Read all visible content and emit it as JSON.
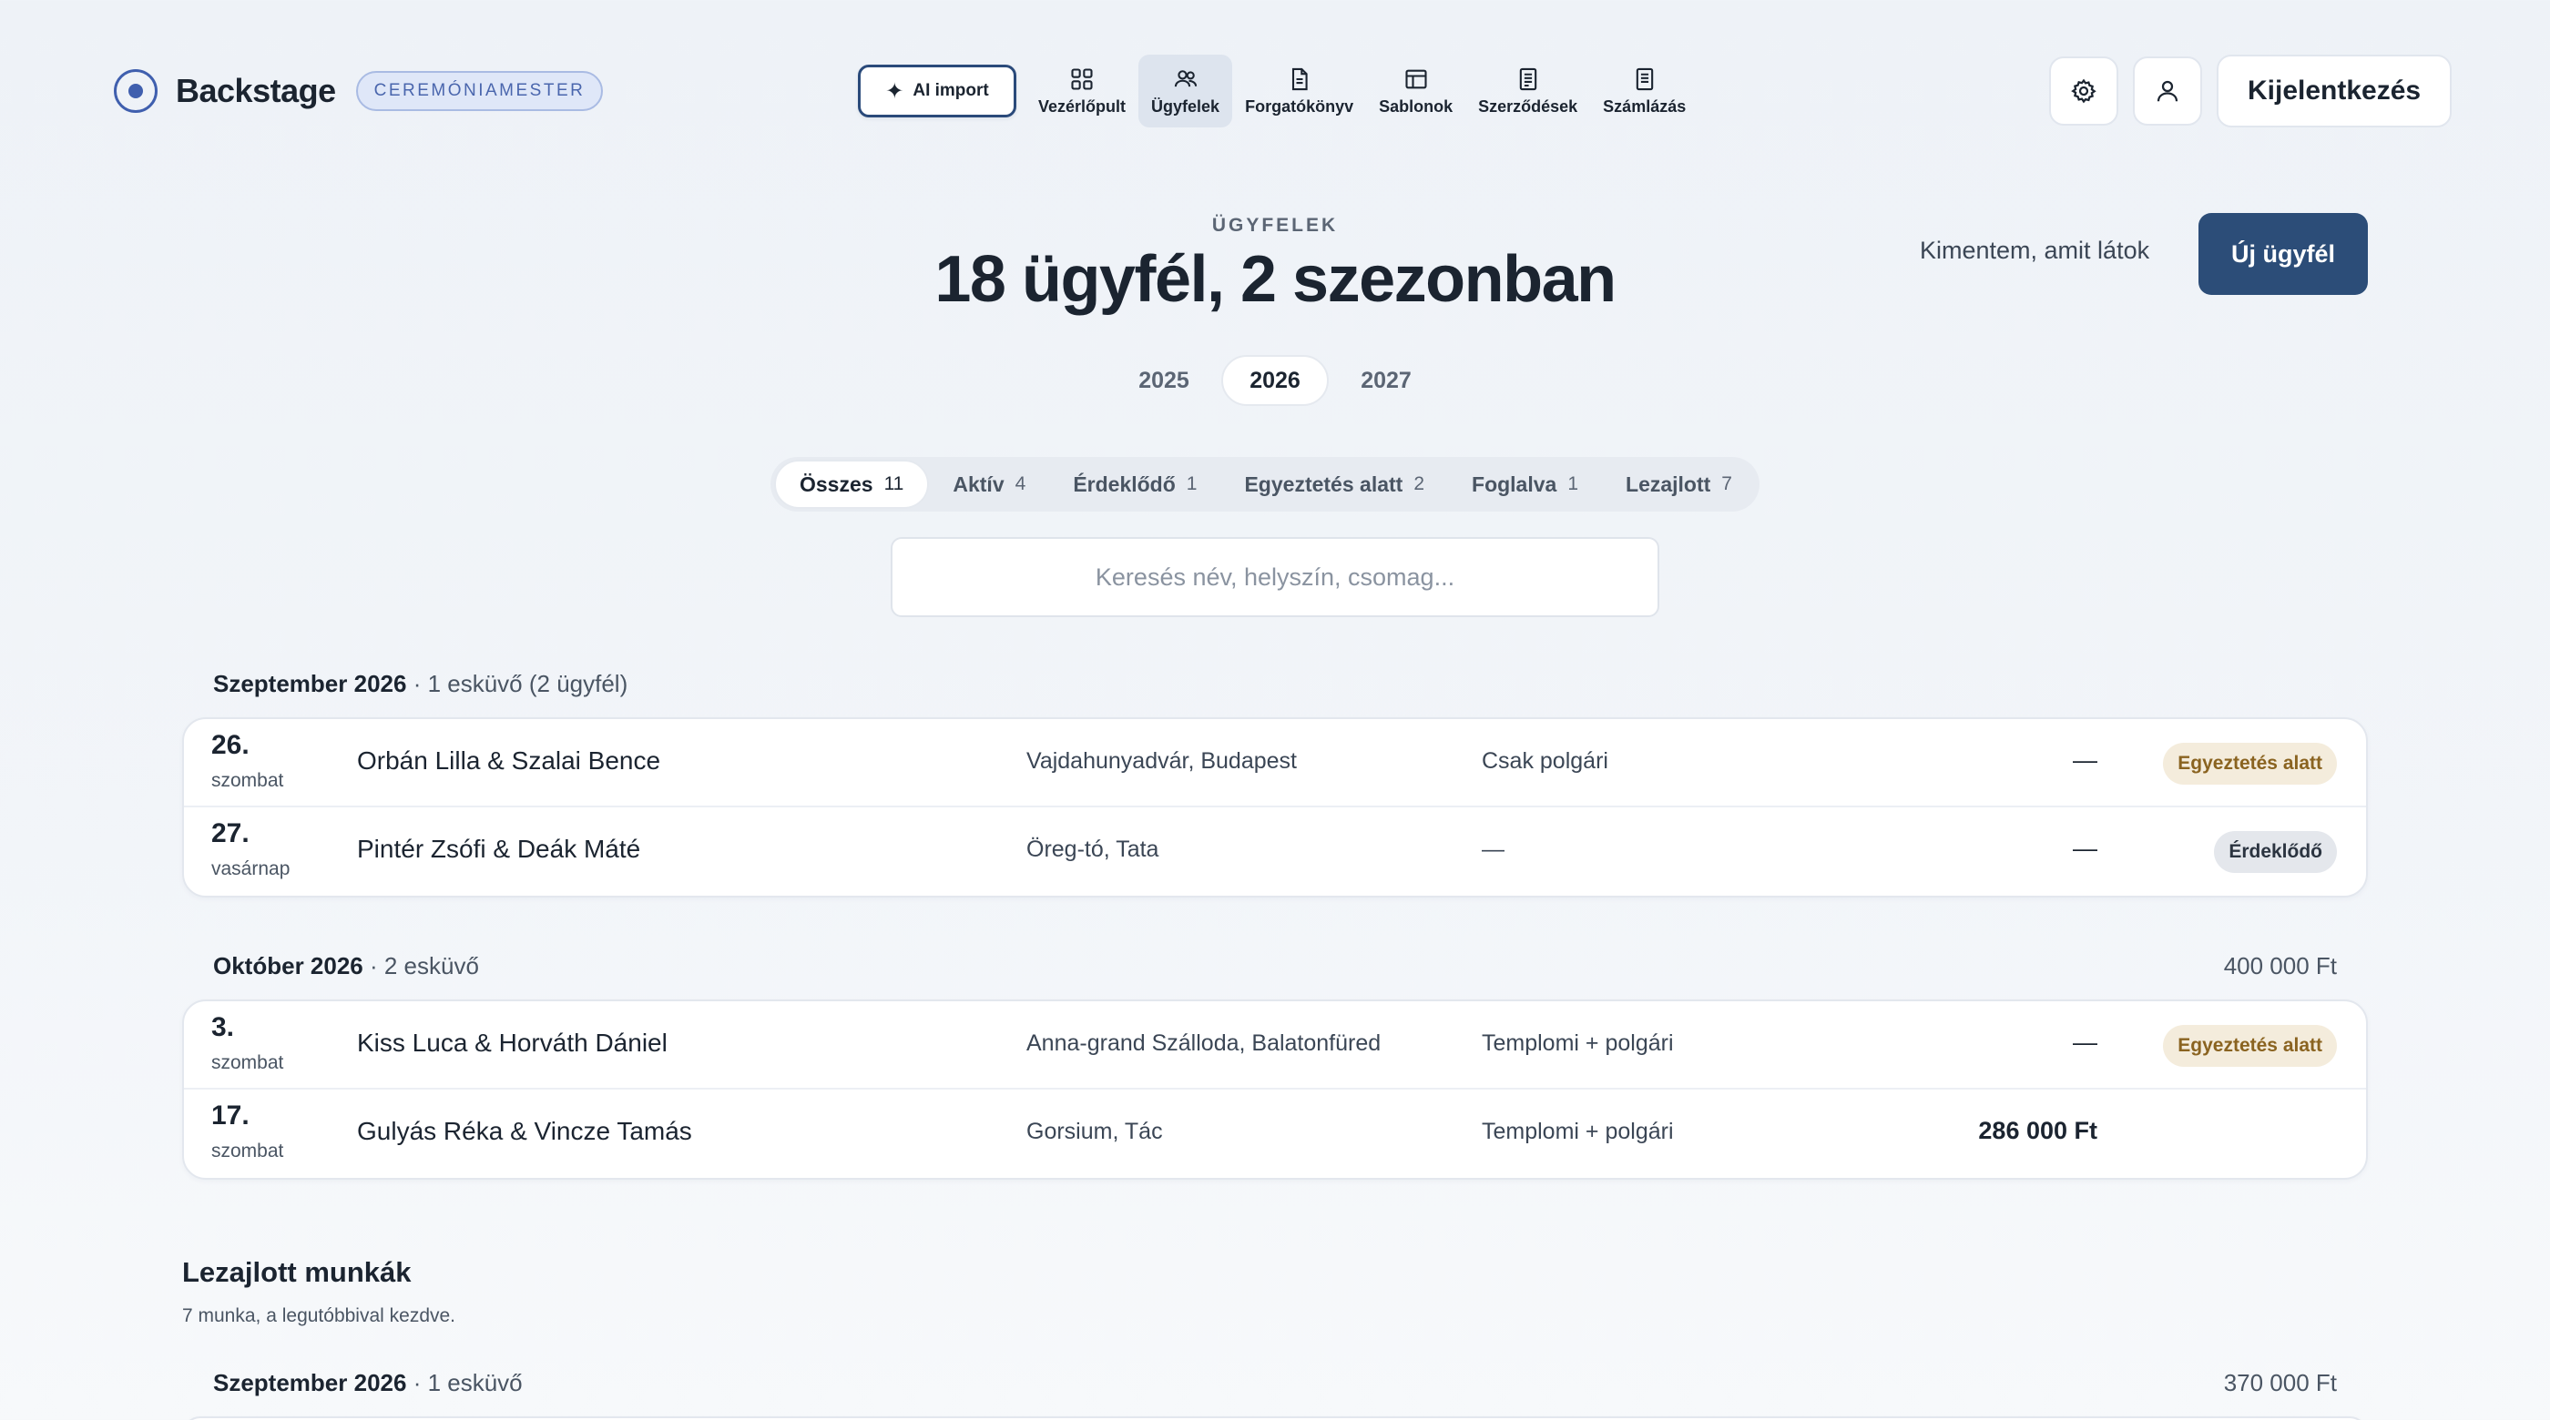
{
  "brand": {
    "name": "Backstage",
    "role": "CEREMÓNIAMESTER"
  },
  "nav": {
    "ai_import": "AI import",
    "items": [
      {
        "label": "Vezérlőpult",
        "icon": "dashboard-icon"
      },
      {
        "label": "Ügyfelek",
        "icon": "users-icon",
        "active": true
      },
      {
        "label": "Forgatókönyv",
        "icon": "document-icon"
      },
      {
        "label": "Sablonok",
        "icon": "template-icon"
      },
      {
        "label": "Szerződések",
        "icon": "contract-icon"
      },
      {
        "label": "Számlázás",
        "icon": "invoice-icon"
      }
    ]
  },
  "header_actions": {
    "logout": "Kijelentkezés"
  },
  "page": {
    "eyebrow": "ÜGYFELEK",
    "title": "18 ügyfél, 2 szezonban",
    "save_view": "Kimentem, amit látok",
    "new_client": "Új ügyfél"
  },
  "years": [
    "2025",
    "2026",
    "2027"
  ],
  "active_year": "2026",
  "filters": [
    {
      "label": "Összes",
      "count": "11",
      "active": true
    },
    {
      "label": "Aktív",
      "count": "4"
    },
    {
      "label": "Érdeklődő",
      "count": "1"
    },
    {
      "label": "Egyeztetés alatt",
      "count": "2"
    },
    {
      "label": "Foglalva",
      "count": "1"
    },
    {
      "label": "Lezajlott",
      "count": "7"
    }
  ],
  "search": {
    "placeholder": "Keresés név, helyszín, csomag..."
  },
  "groups": [
    {
      "month": "Szeptember 2026",
      "sub": "· 1 esküvő (2 ügyfél)",
      "total": "",
      "rows": [
        {
          "day": "26.",
          "weekday": "szombat",
          "couple": "Orbán Lilla & Szalai Bence",
          "venue": "Vajdahunyadvár, Budapest",
          "package": "Csak polgári",
          "amount": "—",
          "status": "Egyeztetés alatt",
          "status_kind": "warn"
        },
        {
          "day": "27.",
          "weekday": "vasárnap",
          "couple": "Pintér Zsófi & Deák Máté",
          "venue": "Öreg-tó, Tata",
          "package": "—",
          "amount": "—",
          "status": "Érdeklődő",
          "status_kind": "neutral"
        }
      ]
    },
    {
      "month": "Október 2026",
      "sub": "· 2 esküvő",
      "total": "400 000 Ft",
      "rows": [
        {
          "day": "3.",
          "weekday": "szombat",
          "couple": "Kiss Luca & Horváth Dániel",
          "venue": "Anna-grand Szálloda, Balatonfüred",
          "package": "Templomi + polgári",
          "amount": "—",
          "status": "Egyeztetés alatt",
          "status_kind": "warn"
        },
        {
          "day": "17.",
          "weekday": "szombat",
          "couple": "Gulyás Réka & Vincze Tamás",
          "venue": "Gorsium, Tác",
          "package": "Templomi + polgári",
          "amount": "286 000 Ft",
          "amount_bold": true,
          "status": "",
          "status_kind": ""
        }
      ]
    }
  ],
  "completed": {
    "title": "Lezajlott munkák",
    "subtitle": "7 munka, a legutóbbival kezdve.",
    "group": {
      "month": "Szeptember 2026",
      "sub": "· 1 esküvő",
      "total": "370 000 Ft"
    }
  },
  "colors": {
    "accent": "#2c4d78",
    "brand": "#3f5fae",
    "warn_bg": "#f4ecdc",
    "warn_text": "#8a6320"
  }
}
